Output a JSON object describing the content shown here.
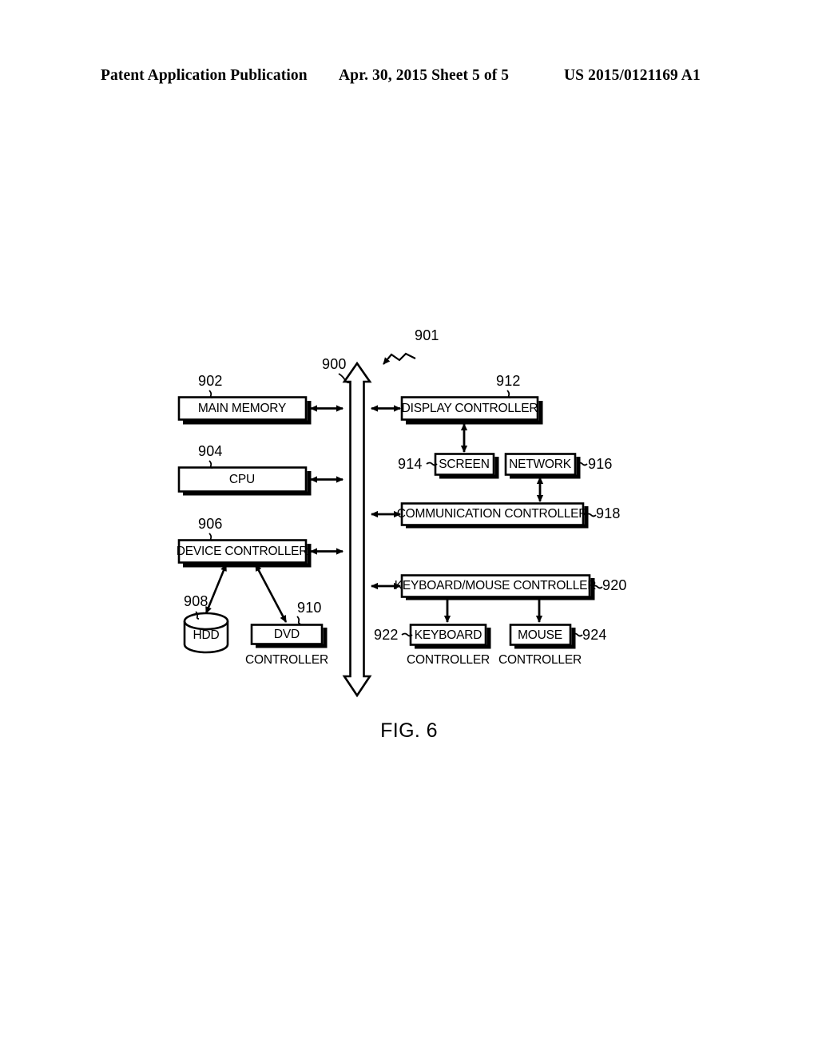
{
  "page_header": {
    "left": "Patent Application Publication",
    "middle": "Apr. 30, 2015  Sheet 5 of 5",
    "right": "US 2015/0121169 A1"
  },
  "figure": {
    "caption": "FIG. 6",
    "system_ref": "901",
    "bus": {
      "label": "900",
      "name": "system-bus"
    },
    "left_column": [
      {
        "id": "main-memory",
        "label": "MAIN MEMORY",
        "ref": "902"
      },
      {
        "id": "cpu",
        "label": "CPU",
        "ref": "904"
      },
      {
        "id": "device-controller",
        "label": "DEVICE CONTROLLER",
        "ref": "906"
      }
    ],
    "storage": [
      {
        "id": "hdd",
        "label": "HDD",
        "ref": "908",
        "shape": "cylinder",
        "sub": ""
      },
      {
        "id": "dvd",
        "label": "DVD",
        "ref": "910",
        "shape": "rect",
        "sub": "CONTROLLER"
      }
    ],
    "right_column": [
      {
        "id": "display-controller",
        "label": "DISPLAY CONTROLLER",
        "ref": "912",
        "ref_side": "top"
      },
      {
        "id": "communication-controller",
        "label": "COMMUNICATION CONTROLLER",
        "ref": "918",
        "ref_side": "right"
      },
      {
        "id": "keyboard-mouse-controller",
        "label": "KEYBOARD/MOUSE CONTROLLER",
        "ref": "920",
        "ref_side": "right"
      }
    ],
    "peripherals": [
      {
        "id": "screen",
        "label": "SCREEN",
        "ref": "914",
        "ref_side": "left",
        "sub": ""
      },
      {
        "id": "network",
        "label": "NETWORK",
        "ref": "916",
        "ref_side": "right",
        "sub": ""
      },
      {
        "id": "keyboard",
        "label": "KEYBOARD",
        "ref": "922",
        "ref_side": "left",
        "sub": "CONTROLLER"
      },
      {
        "id": "mouse",
        "label": "MOUSE",
        "ref": "924",
        "ref_side": "right",
        "sub": "CONTROLLER"
      }
    ]
  }
}
